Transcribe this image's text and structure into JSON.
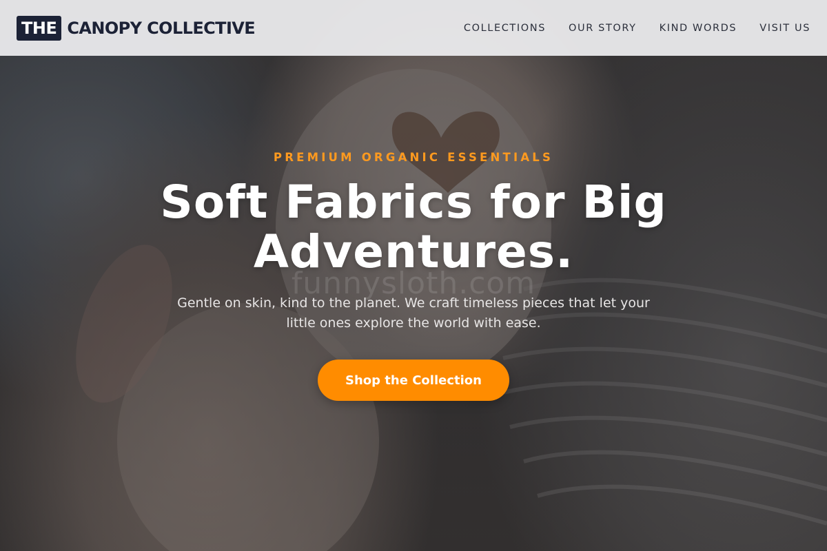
{
  "brand": {
    "logo_box": "THE",
    "logo_text": "CANOPY COLLECTIVE"
  },
  "nav": {
    "items": [
      {
        "label": "COLLECTIONS"
      },
      {
        "label": "OUR STORY"
      },
      {
        "label": "KIND WORDS"
      },
      {
        "label": "VISIT US"
      }
    ]
  },
  "hero": {
    "eyebrow": "PREMIUM ORGANIC ESSENTIALS",
    "headline_line1": "Soft Fabrics for Big",
    "headline_line2": "Adventures.",
    "watermark": "funnysloth.com",
    "subtext": "Gentle on skin, kind to the planet. We craft timeless pieces that let your little ones explore the world with ease.",
    "cta_label": "Shop the Collection"
  },
  "colors": {
    "accent": "#ff8c00",
    "brand_navy": "#1c2236",
    "nav_background": "#ececee"
  }
}
